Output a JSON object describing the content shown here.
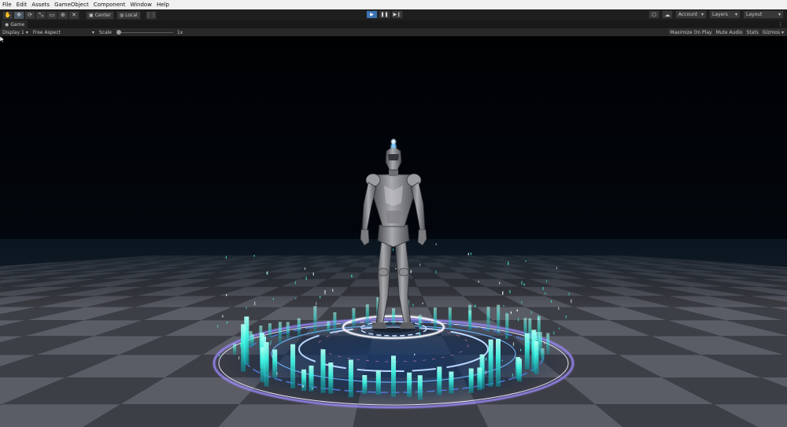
{
  "menu": {
    "items": [
      "File",
      "Edit",
      "Assets",
      "GameObject",
      "Component",
      "Window",
      "Help"
    ]
  },
  "toolbar": {
    "tools": [
      {
        "name": "hand-tool",
        "glyph": "✋"
      },
      {
        "name": "move-tool",
        "glyph": "✥",
        "active": true
      },
      {
        "name": "rotate-tool",
        "glyph": "⟳"
      },
      {
        "name": "scale-tool",
        "glyph": "⤡"
      },
      {
        "name": "rect-tool",
        "glyph": "▭"
      },
      {
        "name": "transform-tool",
        "glyph": "⊕"
      },
      {
        "name": "custom-tool",
        "glyph": "✕"
      }
    ],
    "pivot_label": "Center",
    "space_label": "Local",
    "account_label": "Account",
    "layers_label": "Layers",
    "layout_label": "Layout"
  },
  "tab": {
    "title": "Game"
  },
  "gamebar": {
    "display": "Display 1",
    "aspect": "Free Aspect",
    "scale_label": "Scale",
    "scale_value": "1x",
    "maximize": "Maximize On Play",
    "mute": "Mute Audio",
    "stats": "Stats",
    "gizmos": "Gizmos"
  },
  "colors": {
    "accent": "#3b72b3",
    "glow_cyan": "#3ff2e0",
    "ring_purple": "#9d8bff",
    "floor_light": "#5a5d66",
    "floor_dark": "#3d3f46"
  }
}
